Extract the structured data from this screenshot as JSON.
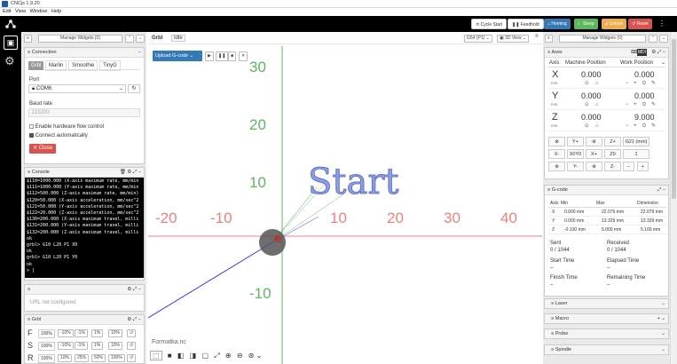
{
  "window": {
    "title": "CNCjs 1.9.20",
    "menu": [
      "Edit",
      "View",
      "Window",
      "Help"
    ]
  },
  "topbar": {
    "cycle_start": "Cycle Start",
    "feedhold": "Feedhold",
    "homing": "Homing",
    "sleep": "Sleep",
    "unlock": "Unlock",
    "reset": "Reset"
  },
  "left": {
    "manage_widgets": "Manage Widgets (0)",
    "connection": {
      "title": "Connection",
      "tabs": [
        "Grbl",
        "Marlin",
        "Smoothie",
        "TinyG"
      ],
      "port_label": "Port",
      "port_value": "COM6",
      "baud_label": "Baud rate",
      "baud_value": "115200",
      "hw_flow": "Enable hardware flow control",
      "auto_connect": "Connect automatically",
      "close": "Close"
    },
    "console": {
      "title": "Console",
      "lines": [
        "$110=1000.000 (X-axis maximum rate, mm/min",
        "$111=1000.000 (Y-axis maximum rate, mm/min",
        "$112=500.000 (Z-axis maximum rate, mm/min)",
        "$120=50.000 (X-axis acceleration, mm/sec^2",
        "$121=50.000 (Y-axis acceleration, mm/sec^2",
        "$122=20.000 (Z-axis acceleration, mm/sec^2",
        "$130=200.000 (X-axis maximum travel, milli",
        "$131=200.000 (Y-axis maximum travel, milli",
        "$132=200.000 (Z-axis maximum travel, milli",
        "ok",
        "grbl> G10 L20 P1 X0",
        "ok",
        "grbl> G10 L20 P1 Y0",
        "ok",
        "> |"
      ]
    },
    "webcam": {
      "text": "URL not configured"
    },
    "grbl": {
      "title": "Grbl",
      "rows": [
        {
          "label": "F",
          "pct": "100%",
          "btns": [
            "-10%",
            "-1%",
            "1%",
            "10%"
          ]
        },
        {
          "label": "S",
          "pct": "100%",
          "btns": [
            "-10%",
            "-1%",
            "1%",
            "10%"
          ]
        },
        {
          "label": "R",
          "pct": "100%",
          "btns": [
            "10%",
            "25%",
            "50%",
            "100%"
          ]
        }
      ]
    }
  },
  "viz": {
    "tab_grbl": "Grbl",
    "tab_state": "Idle",
    "upload": "Upload G-code",
    "wcs": "G54 (P1)",
    "view": "3D View",
    "gcode_text": "Start",
    "filename": "Formatka.nc",
    "x_ticks": [
      "-20",
      "-10",
      "10",
      "20",
      "30",
      "40"
    ],
    "y_ticks": [
      "30",
      "20",
      "10",
      "-10"
    ]
  },
  "right": {
    "manage_widgets": "Manage Widgets (0)",
    "axes": {
      "title": "Axes",
      "mdi": "MDI",
      "col_axis": "Axis",
      "col_mpos": "Machine Position",
      "col_wpos": "Work Position",
      "rows": [
        {
          "axis": "X",
          "unit": "mm",
          "mpos": "0.000",
          "wpos": "0.000"
        },
        {
          "axis": "Y",
          "unit": "mm",
          "mpos": "0.000",
          "wpos": "0.000"
        },
        {
          "axis": "Z",
          "unit": "mm",
          "mpos": "0.000",
          "wpos": "9.000"
        }
      ],
      "jog": [
        [
          "Y+",
          "Z+"
        ],
        [
          "X-",
          "X0Y0",
          "X+",
          "Z0"
        ],
        [
          "Y-",
          "Z-"
        ]
      ],
      "units": "G21 (mm)",
      "step": "1"
    },
    "gcode": {
      "title": "G-code",
      "cols": [
        "Axis",
        "Min",
        "Max",
        "Dimension"
      ],
      "rows": [
        {
          "axis": "X",
          "min": "0.000 mm",
          "max": "22.079 mm",
          "dim": "22.079 mm"
        },
        {
          "axis": "Y",
          "min": "0.000 mm",
          "max": "13.329 mm",
          "dim": "13.329 mm"
        },
        {
          "axis": "Z",
          "min": "-0.100 mm",
          "max": "5.000 mm",
          "dim": "5.100 mm"
        }
      ],
      "sent_label": "Sent",
      "sent": "0 / 1044",
      "received_label": "Received",
      "received": "0 / 1044",
      "start_label": "Start Time",
      "start": "–",
      "elapsed_label": "Elapsed Time",
      "elapsed": "–",
      "finish_label": "Finish Time",
      "finish": "–",
      "remaining_label": "Remaining Time",
      "remaining": "–"
    },
    "collapsed": [
      "Laser",
      "Macro",
      "Probe",
      "Spindle"
    ]
  }
}
